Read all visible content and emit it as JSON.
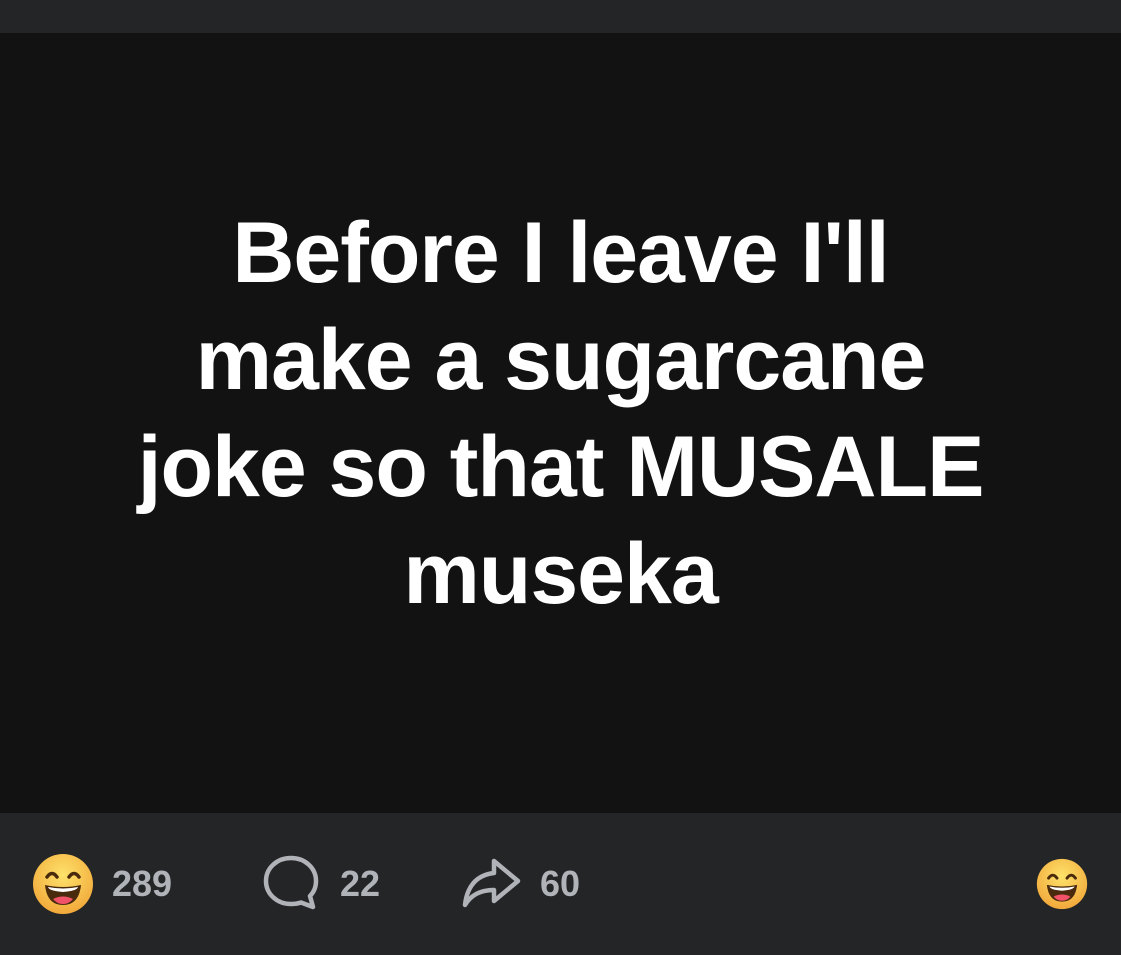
{
  "post": {
    "lines": [
      "Before I leave I'll",
      "make a sugarcane",
      "joke so that MUSALE",
      "museka"
    ]
  },
  "actions": {
    "reactions": {
      "icon": "laughing-face-icon",
      "count": "289"
    },
    "comments": {
      "icon": "comment-bubble-icon",
      "count": "22"
    },
    "shares": {
      "icon": "share-arrow-icon",
      "count": "60"
    },
    "react_button": {
      "icon": "laughing-face-icon"
    }
  },
  "colors": {
    "background": "#242526",
    "post_background": "#121212",
    "post_text": "#ffffff",
    "count_text": "#b0b3b8",
    "emoji_yellow": "#f7c23c"
  }
}
